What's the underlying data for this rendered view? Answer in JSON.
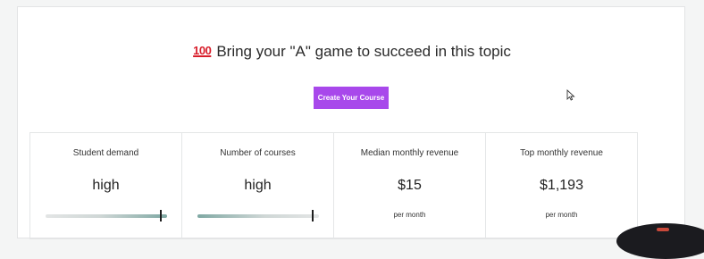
{
  "header": {
    "emoji_text": "100",
    "title": "Bring your \"A\" game to succeed in this topic"
  },
  "cta": {
    "label": "Create Your Course"
  },
  "stats": [
    {
      "label": "Student demand",
      "value": "high",
      "meter_level": 0.95
    },
    {
      "label": "Number of courses",
      "value": "high",
      "meter_level": 0.95
    },
    {
      "label": "Median monthly revenue",
      "value": "$15",
      "sub": "per month"
    },
    {
      "label": "Top monthly revenue",
      "value": "$1,193",
      "sub": "per month"
    }
  ],
  "colors": {
    "accent": "#a848eb",
    "meter_teal": "#7fa8a3",
    "emoji_red": "#d81e2b"
  }
}
